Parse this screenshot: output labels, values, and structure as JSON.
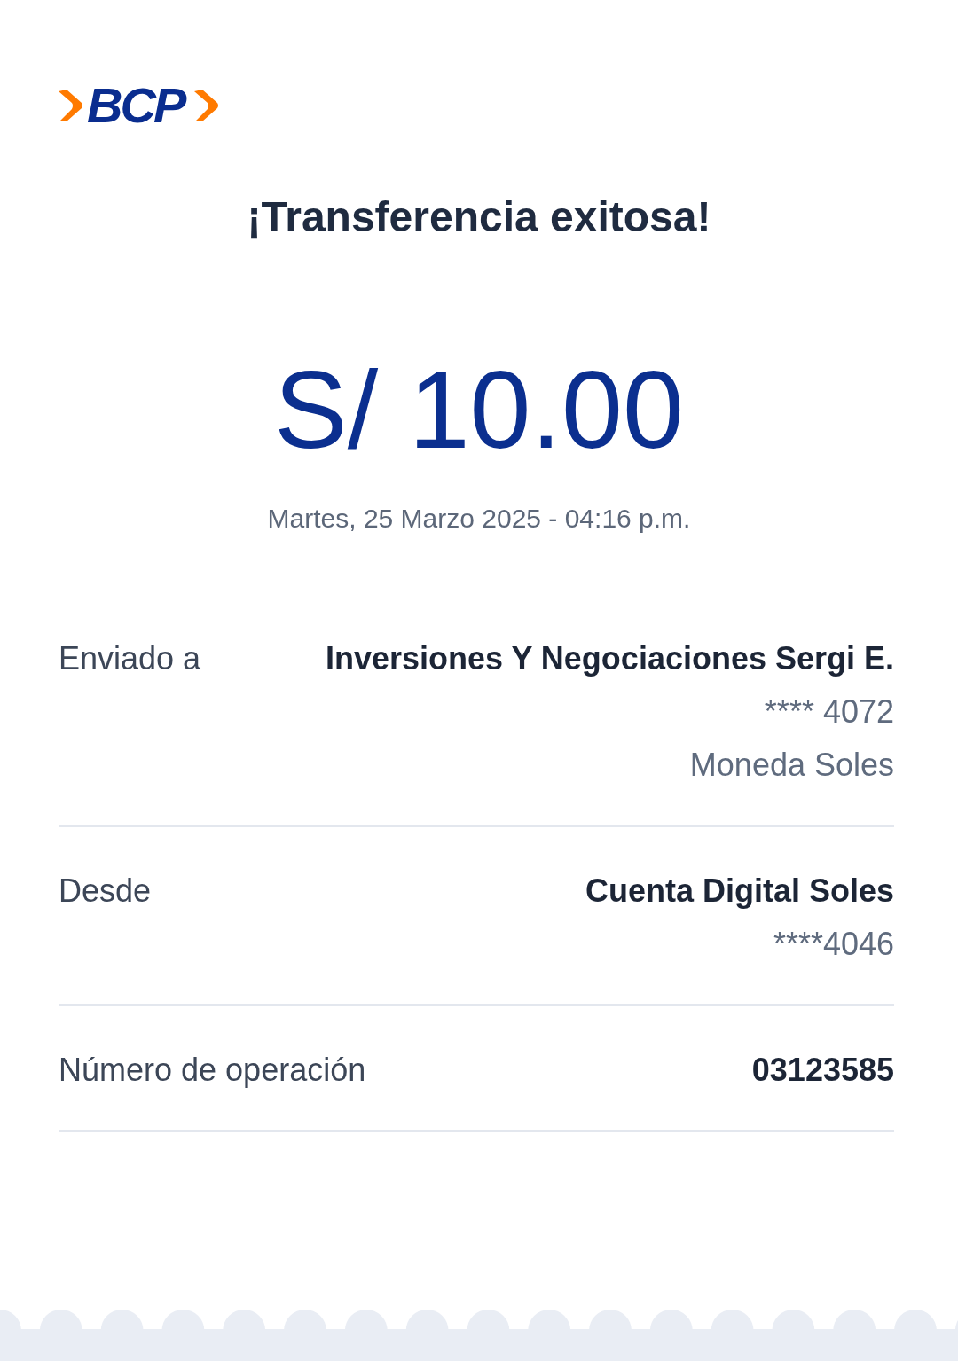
{
  "logo": {
    "text": "BCP"
  },
  "title": "¡Transferencia exitosa!",
  "amount": "S/ 10.00",
  "datetime": "Martes, 25 Marzo 2025 - 04:16 p.m.",
  "details": [
    {
      "label": "Enviado a",
      "values": [
        {
          "text": "Inversiones Y Negociaciones Sergi E.",
          "kind": "primary"
        },
        {
          "text": "**** 4072",
          "kind": "secondary"
        },
        {
          "text": "Moneda Soles",
          "kind": "secondary"
        }
      ]
    },
    {
      "label": "Desde",
      "values": [
        {
          "text": "Cuenta Digital Soles",
          "kind": "primary"
        },
        {
          "text": "****4046",
          "kind": "secondary"
        }
      ]
    },
    {
      "label": "Número de operación",
      "values": [
        {
          "text": "03123585",
          "kind": "primary"
        }
      ]
    }
  ]
}
